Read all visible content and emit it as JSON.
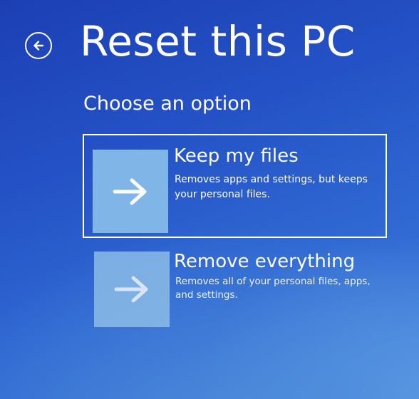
{
  "header": {
    "back_icon": "back-arrow-circle-icon",
    "title": "Reset this PC"
  },
  "subtitle": "Choose an option",
  "options": [
    {
      "icon": "arrow-right-icon",
      "title": "Keep my files",
      "description": "Removes apps and settings, but keeps your personal files.",
      "selected": true
    },
    {
      "icon": "arrow-right-icon",
      "title": "Remove everything",
      "description": "Removes all of your personal files, apps, and settings.",
      "selected": false
    }
  ],
  "colors": {
    "background": "#2452c6",
    "text": "#ffffff",
    "tile_selected": "#7fb6e7",
    "tile": "#8fbfe8"
  }
}
